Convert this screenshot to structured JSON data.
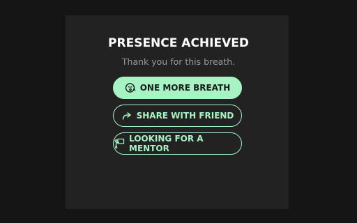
{
  "completion": {
    "title": "PRESENCE ACHIEVED",
    "subtitle": "Thank you for this breath."
  },
  "actions": [
    {
      "label": "ONE MORE BREATH",
      "icon": "face-exhale-icon",
      "style": "primary"
    },
    {
      "label": "SHARE WITH FRIEND",
      "icon": "share-arrow-icon",
      "style": "outline"
    },
    {
      "label": "LOOKING FOR A MENTOR",
      "icon": "mentor-icon",
      "style": "outline"
    }
  ],
  "colors": {
    "background": "#151515",
    "panel": "#222222",
    "accent": "#a7f3c3",
    "title": "#ffffff",
    "subtitle": "#9a9a9a"
  }
}
